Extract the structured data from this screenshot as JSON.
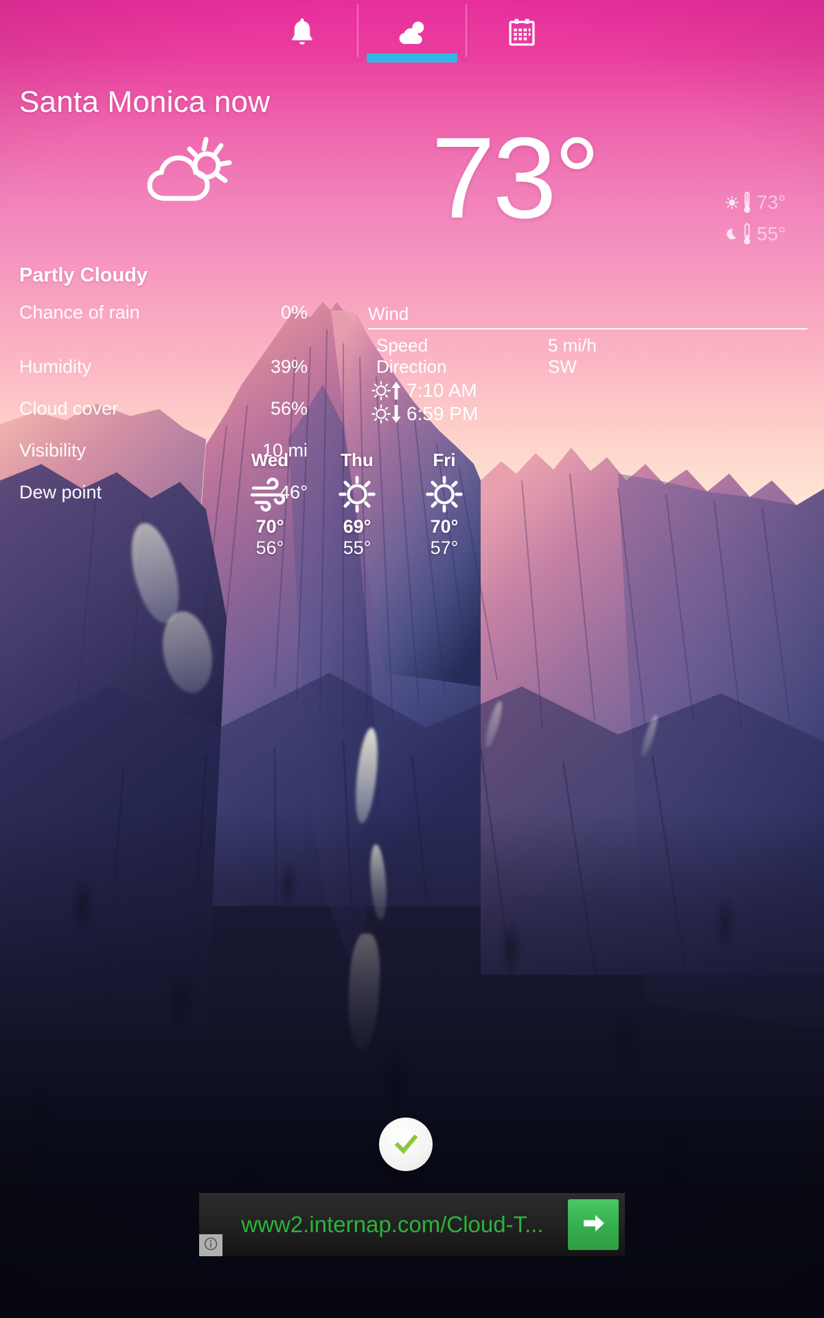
{
  "tabs": [
    {
      "name": "alerts",
      "icon": "bell-icon",
      "active": false
    },
    {
      "name": "weather",
      "icon": "cloud-sun-icon",
      "active": true
    },
    {
      "name": "calendar",
      "icon": "calendar-icon",
      "active": false
    }
  ],
  "accent_color": "#33b5e5",
  "header": {
    "location_line": "Santa Monica now"
  },
  "current": {
    "icon": "partly-cloudy-icon",
    "temperature": "73°",
    "condition": "Partly Cloudy",
    "day_high": "73°",
    "night_low": "55°",
    "day_icon": "sun-icon",
    "night_icon": "moon-icon"
  },
  "details": {
    "chance_of_rain": {
      "label": "Chance of rain",
      "value": "0%"
    },
    "humidity": {
      "label": "Humidity",
      "value": "39%"
    },
    "cloud_cover": {
      "label": "Cloud cover",
      "value": "56%"
    },
    "visibility": {
      "label": "Visibility",
      "value": "10 mi"
    },
    "dew_point": {
      "label": "Dew point",
      "value": "46°"
    }
  },
  "wind": {
    "title": "Wind",
    "speed_label": "Speed",
    "speed_value": "5 mi/h",
    "direction_label": "Direction",
    "direction_value": "SW"
  },
  "sun": {
    "sunrise": "7:10 AM",
    "sunset": "6:59 PM"
  },
  "forecast": [
    {
      "day": "Wed",
      "icon": "wind-icon",
      "high": "70°",
      "low": "56°"
    },
    {
      "day": "Thu",
      "icon": "sunny-icon",
      "high": "69°",
      "low": "55°"
    },
    {
      "day": "Fri",
      "icon": "sunny-icon",
      "high": "70°",
      "low": "57°"
    }
  ],
  "overlay": {
    "check_badge_icon": "green-check-icon"
  },
  "ad": {
    "url_text": "www2.internap.com/Cloud-T...",
    "url_color": "#2ab43c",
    "go_icon": "arrow-right-icon",
    "info_icon": "info-icon"
  }
}
